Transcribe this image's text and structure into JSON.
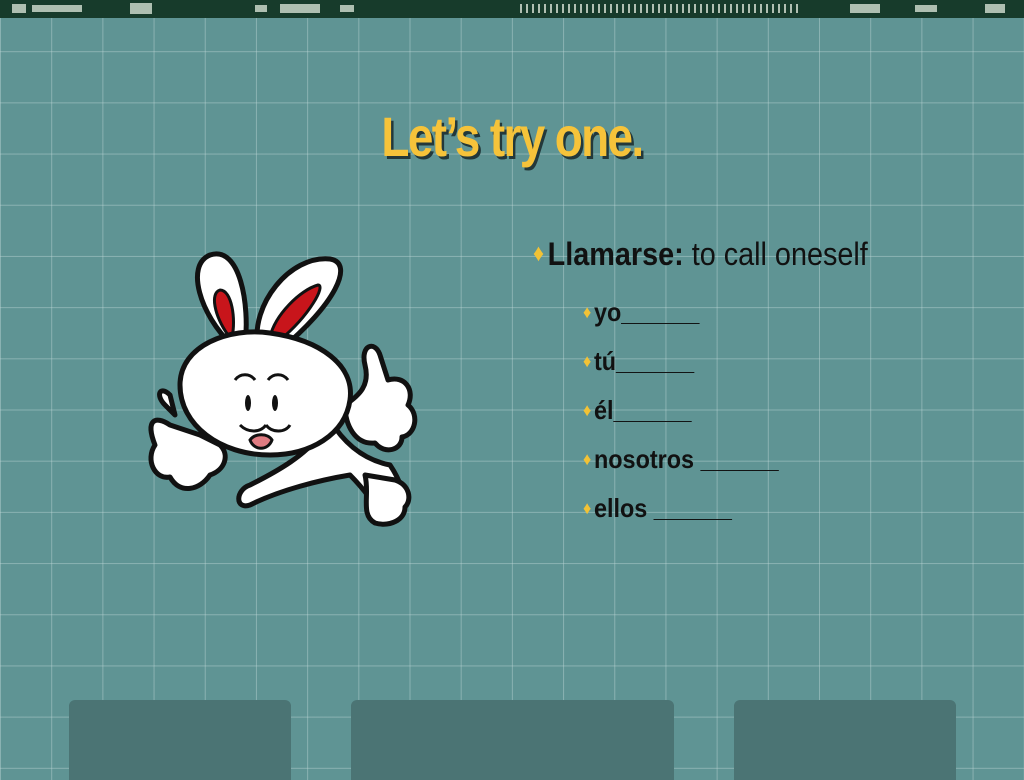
{
  "slide": {
    "title": "Let’s try one.",
    "main_bullet": {
      "term": "Llamarse:",
      "definition": " to call oneself"
    },
    "sub_items": [
      {
        "label": "yo______"
      },
      {
        "label": "tú______"
      },
      {
        "label": "él______"
      },
      {
        "label": "nosotros ______"
      },
      {
        "label": "ellos ______"
      }
    ]
  },
  "decor": {
    "background_color": "#5f9494",
    "title_color": "#f6c33a",
    "bullet_color": "#f2c235",
    "tab_color": "#4b7474",
    "strip_color": "#173b2b",
    "clipart": "thumbs-up-rabbit"
  }
}
